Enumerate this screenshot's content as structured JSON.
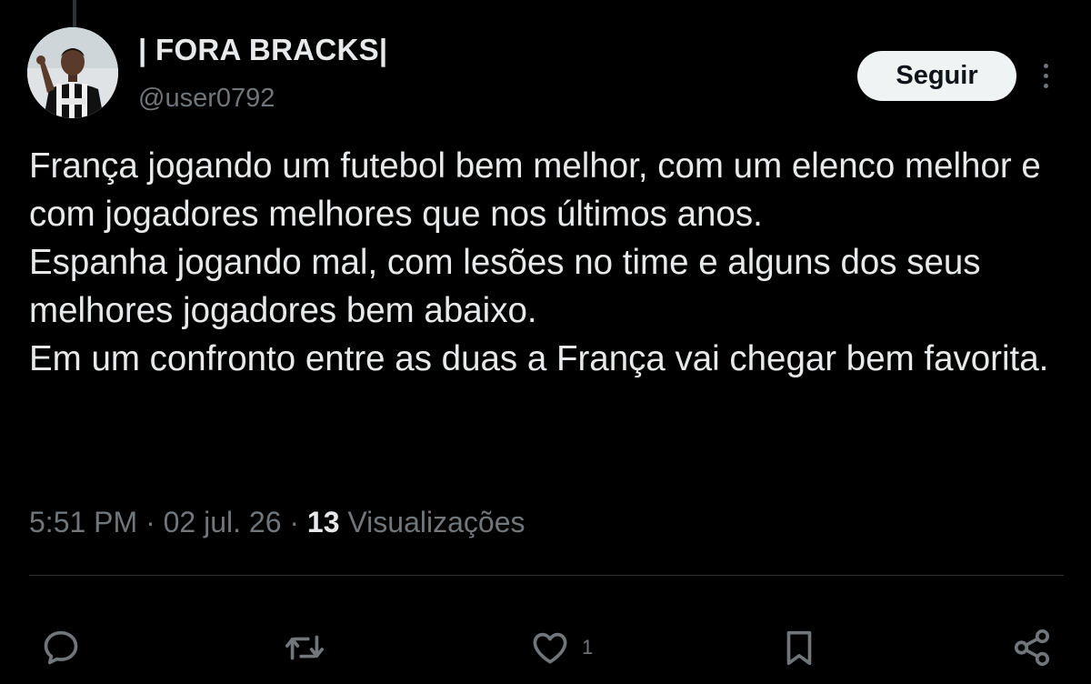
{
  "user": {
    "display_name": "| FORA BRACKS|",
    "handle": "@user0792",
    "avatar_icon": "profile-avatar"
  },
  "follow_label": "Seguir",
  "more_icon": "more-options-icon",
  "tweet": {
    "lines": [
      "França jogando um futebol bem melhor, com um elenco melhor e com jogadores melhores que nos últimos anos.",
      "Espanha jogando mal, com lesões no time e alguns dos seus melhores jogadores bem abaixo.",
      "Em um confronto entre as duas a França vai chegar bem favorita."
    ]
  },
  "meta": {
    "time": "5:51 PM",
    "separator": "·",
    "date": "02 jul. 26",
    "views_count": "13",
    "views_label": "Visualizações"
  },
  "actions": {
    "reply_icon": "reply-icon",
    "retweet_icon": "retweet-icon",
    "like_icon": "heart-icon",
    "like_count": "1",
    "bookmark_icon": "bookmark-icon",
    "share_icon": "share-icon"
  },
  "colors": {
    "background": "#000000",
    "primary_text": "#e7e9ea",
    "secondary_text": "#71767b",
    "button_bg": "#eff3f4",
    "divider": "#2f3336"
  }
}
